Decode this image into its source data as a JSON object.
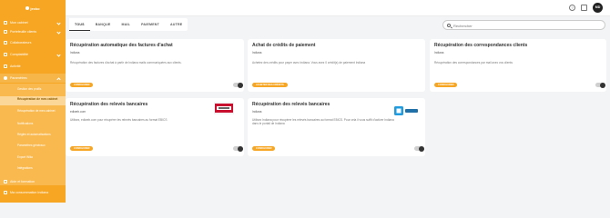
{
  "sidebar": {
    "logo": "jecko",
    "items": [
      {
        "label": "Mon cabinet",
        "chev": "down"
      },
      {
        "label": "Portefeuille clients",
        "chev": "down"
      },
      {
        "label": "Collaborateurs",
        "chev": ""
      },
      {
        "label": "Comptabilité",
        "chev": "down"
      },
      {
        "label": "Activité",
        "chev": ""
      },
      {
        "label": "Paramètres",
        "chev": "up"
      }
    ],
    "subitems": [
      "Gestion des profils",
      "Récupération de mes cabinet",
      "Récupération de mes cabinet",
      "Notifications",
      "Règles et automatisations",
      "Paramètres généraux",
      "Export Wiko",
      "Intégrations"
    ],
    "bottom_items": [
      "Aide et formation",
      "Ma consommation Indiana"
    ]
  },
  "topbar": {
    "help_icon": "help-icon",
    "gift_icon": "gift-icon",
    "avatar_initials": "MD"
  },
  "filters": {
    "tabs": [
      "TOUS",
      "BANQUE",
      "MAIL",
      "PAIEMENT",
      "AUTRE"
    ],
    "active_tab": "TOUS",
    "search_placeholder": "Rechercher"
  },
  "cards": [
    {
      "title": "Récupération automatique des factures d'achat",
      "subtitle": "Indiana",
      "description": "Récupération des factures d'achat à partir de Indiana mails communiquées aux clients.",
      "button": "Configurer"
    },
    {
      "title": "Achat de crédits de paiement",
      "subtitle": "Indiana",
      "description": "Achetez des crédits pour payer avec Indiana. Vous avez 0 crédit(s) de paiement Indiana",
      "button": "Acheter des crédits"
    },
    {
      "title": "Récupération des correspondances clients",
      "subtitle": "Indiana",
      "description": "Récupération des correspondances par mail avec vos clients",
      "button": "Configurer"
    },
    {
      "title": "Récupération des relevés bancaires",
      "subtitle": "ediweb.com",
      "description": "Utilisez, ediweb.com pour récupérer les relevés bancaires au format EBICS",
      "button": "Configurer",
      "logo": "ediweb"
    },
    {
      "title": "Récupération des relevés bancaires",
      "subtitle": "Indiana",
      "description": "Utilisez Indiana pour récupérer les relevés bancaires au format EBICS. Pour cela il vous suffit d'activer Indiana dans le portail de Indiana",
      "button": "Configurer",
      "logo": "bankin"
    }
  ],
  "colors": {
    "accent": "#f6a623",
    "sidebar": "#f6a623",
    "background": "#f3f4f5"
  }
}
